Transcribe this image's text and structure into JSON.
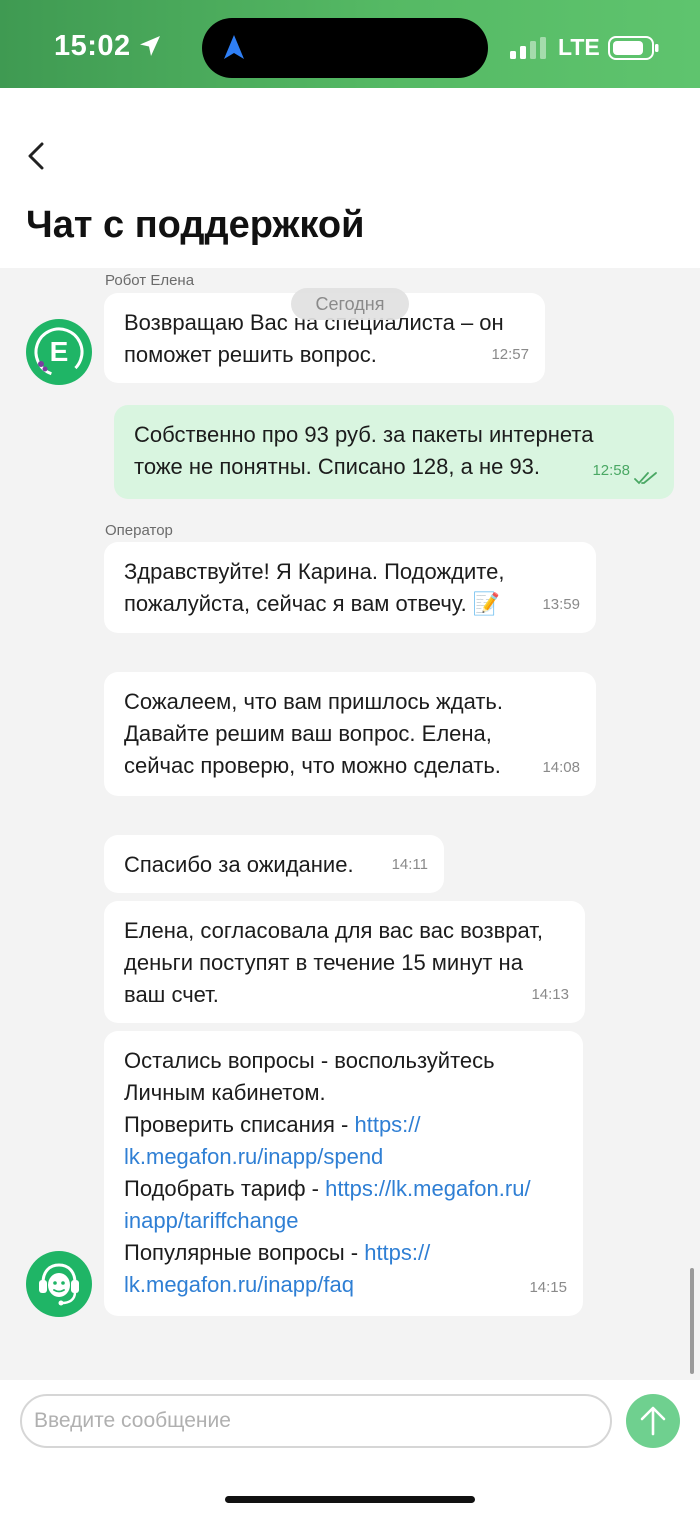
{
  "status_bar": {
    "time": "15:02",
    "network": "LTE"
  },
  "header": {
    "title": "Чат с поддержкой"
  },
  "chat": {
    "date_separator": "Сегодня",
    "robot_sender": "Робот Елена",
    "robot_avatar_letter": "E",
    "operator_sender": "Оператор",
    "messages": [
      {
        "text": "Возвращаю Вас на специалиста – он\nпоможет решить вопрос.",
        "time": "12:57"
      },
      {
        "text": "Собственно про 93 руб. за пакеты интернета\nтоже не понятны. Списано 128, а не 93.",
        "time": "12:58"
      },
      {
        "text": "Здравствуйте! Я Карина. Подождите,\nпожалуйста, сейчас я вам отвечу. 📝",
        "time": "13:59"
      },
      {
        "text": "Сожалеем, что вам пришлось ждать.\nДавайте решим ваш вопрос. Елена,\nсейчас проверю, что можно сделать.",
        "time": "14:08"
      },
      {
        "text": "Спасибо за ожидание.",
        "time": "14:11"
      },
      {
        "text": "Елена, согласовала для вас вас возврат,\nденьги поступят в течение 15 минут на\nваш счет.",
        "time": "14:13"
      },
      {
        "intro_1": "Остались вопросы - воспользуйтесь",
        "intro_2": "Личным кабинетом.",
        "spend_label": "Проверить списания - ",
        "spend_link_1": "https://",
        "spend_link_2": "lk.megafon.ru/inapp/spend",
        "tariff_label": "Подобрать тариф - ",
        "tariff_link_1": "https://lk.megafon.ru/",
        "tariff_link_2": "inapp/tariffchange",
        "faq_label": "Популярные вопросы - ",
        "faq_link_1": "https://",
        "faq_link_2": "lk.megafon.ru/inapp/faq",
        "time": "14:15"
      }
    ]
  },
  "composer": {
    "placeholder": "Введите сообщение"
  },
  "colors": {
    "brand_green": "#1fb566",
    "outgoing_bubble": "#d9f5e0",
    "link": "#2f7fd4",
    "send_button": "#6fd08f"
  }
}
